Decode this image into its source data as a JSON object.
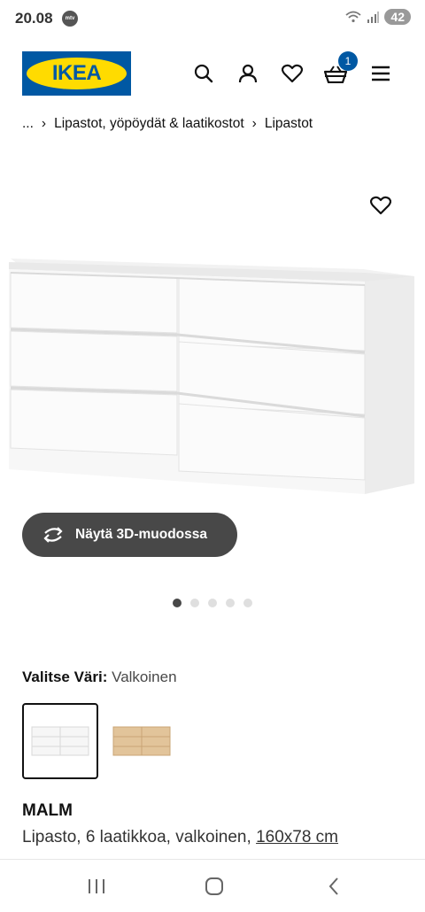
{
  "status_bar": {
    "time": "20.08",
    "mtv_label": "mtv",
    "battery": "42"
  },
  "header": {
    "logo_text": "IKEA",
    "cart_count": "1",
    "icons": [
      "search-icon",
      "user-icon",
      "heart-icon",
      "basket-icon",
      "menu-icon"
    ]
  },
  "breadcrumb": {
    "ellipsis": "...",
    "items": [
      "Lipastot, yöpöydät & laatikostot",
      "Lipastot"
    ]
  },
  "gallery": {
    "button_3d_label": "Näytä 3D-muodossa",
    "image_count": 5,
    "active_index": 0
  },
  "color": {
    "label": "Valitse Väri:",
    "value": "Valkoinen",
    "options": [
      "white",
      "oak"
    ]
  },
  "product": {
    "name": "MALM",
    "description": "Lipasto, 6 laatikkoa, valkoinen,",
    "size_link": "160x78 cm"
  },
  "colors": {
    "ikea_blue": "#0058a3",
    "ikea_yellow": "#ffdb00",
    "button_dark": "#484848"
  }
}
